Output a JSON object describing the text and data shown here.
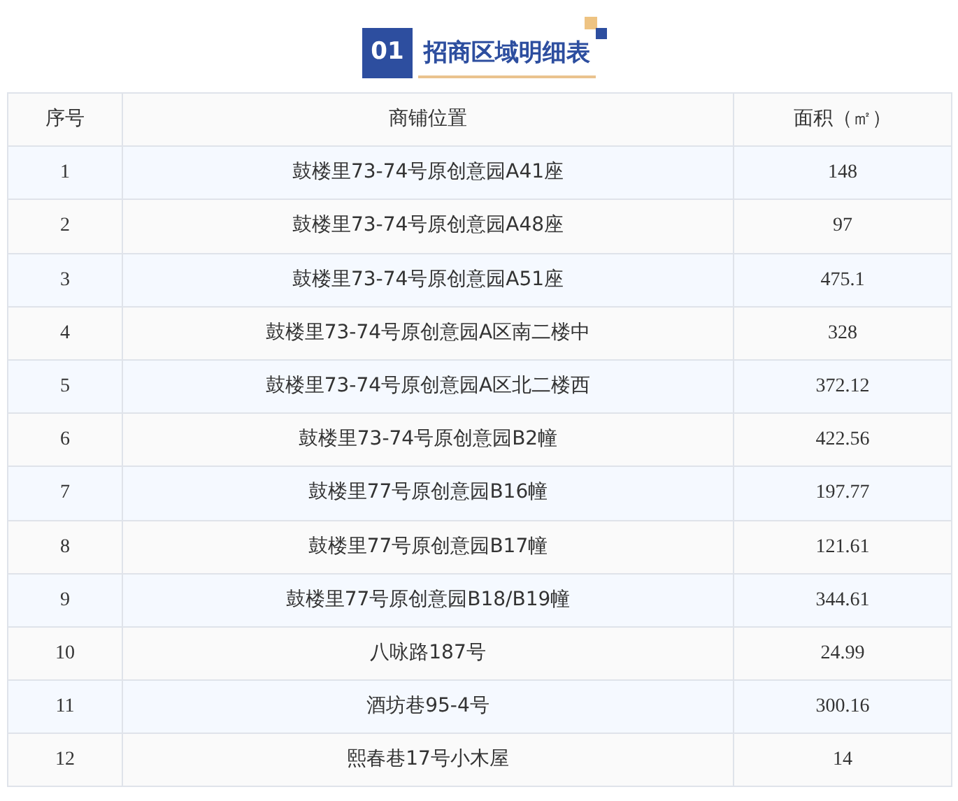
{
  "heading": {
    "number": "01",
    "title": "招商区域明细表"
  },
  "table": {
    "columns": [
      "序号",
      "商铺位置",
      "面积（㎡）"
    ],
    "rows": [
      [
        "1",
        "鼓楼里73-74号原创意园A41座",
        "148"
      ],
      [
        "2",
        "鼓楼里73-74号原创意园A48座",
        "97"
      ],
      [
        "3",
        "鼓楼里73-74号原创意园A51座",
        "475.1"
      ],
      [
        "4",
        "鼓楼里73-74号原创意园A区南二楼中",
        "328"
      ],
      [
        "5",
        "鼓楼里73-74号原创意园A区北二楼西",
        "372.12"
      ],
      [
        "6",
        "鼓楼里73-74号原创意园B2幢",
        "422.56"
      ],
      [
        "7",
        "鼓楼里77号原创意园B16幢",
        "197.77"
      ],
      [
        "8",
        "鼓楼里77号原创意园B17幢",
        "121.61"
      ],
      [
        "9",
        "鼓楼里77号原创意园B18/B19幢",
        "344.61"
      ],
      [
        "10",
        "八咏路187号",
        "24.99"
      ],
      [
        "11",
        "酒坊巷95-4号",
        "300.16"
      ],
      [
        "12",
        "熙春巷17号小木屋",
        "14"
      ]
    ]
  }
}
